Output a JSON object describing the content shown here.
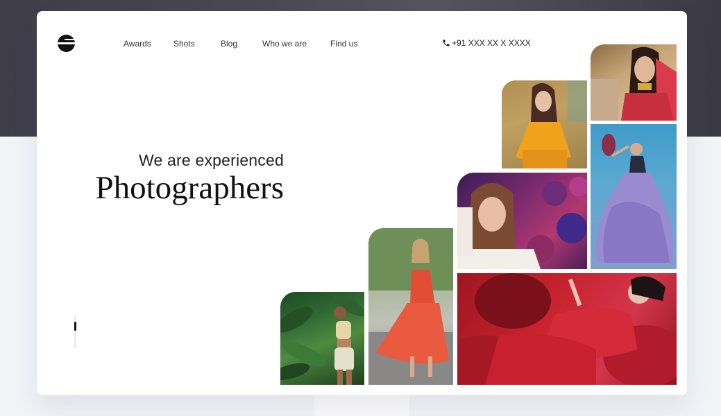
{
  "nav": {
    "items": [
      {
        "label": "Awards"
      },
      {
        "label": "Shots"
      },
      {
        "label": "Blog"
      },
      {
        "label": "Who we are"
      },
      {
        "label": "Find us"
      }
    ]
  },
  "contact": {
    "phone": "+91 XXX XX X XXXX"
  },
  "hero": {
    "subtitle": "We are experienced",
    "title": "Photographers"
  },
  "gallery": {
    "photos": [
      {
        "icon": "woman-in-leaves-photo"
      },
      {
        "icon": "woman-orange-dress-photo"
      },
      {
        "icon": "woman-purple-flowers-photo"
      },
      {
        "icon": "woman-red-gown-photo"
      },
      {
        "icon": "woman-yellow-dress-field-photo"
      },
      {
        "icon": "bride-portrait-photo"
      },
      {
        "icon": "woman-lavender-gown-photo"
      }
    ]
  },
  "colors": {
    "accent": "#111111",
    "background": "#ffffff"
  }
}
